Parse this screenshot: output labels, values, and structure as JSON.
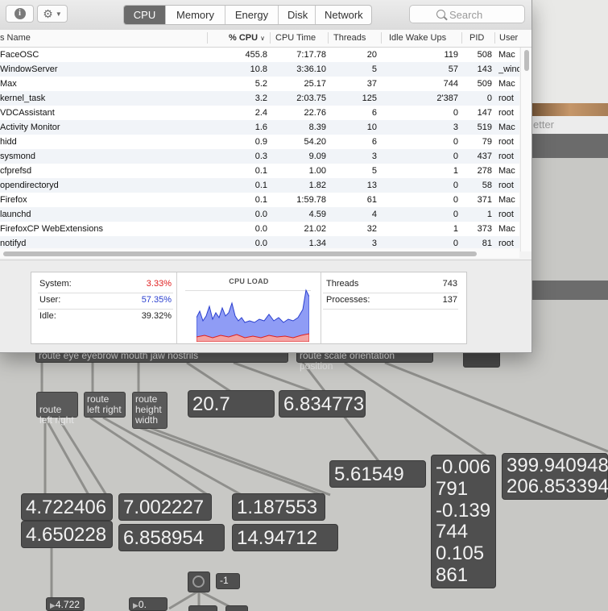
{
  "toolbar": {
    "info_icon": "info-icon",
    "gear_icon": "gear-icon",
    "tabs": [
      {
        "label": "CPU",
        "active": true
      },
      {
        "label": "Memory",
        "active": false
      },
      {
        "label": "Energy",
        "active": false
      },
      {
        "label": "Disk",
        "active": false
      },
      {
        "label": "Network",
        "active": false
      }
    ],
    "search_placeholder": "Search"
  },
  "table": {
    "columns": [
      "s Name",
      "% CPU",
      "CPU Time",
      "Threads",
      "Idle Wake Ups",
      "PID",
      "User"
    ],
    "rows": [
      [
        "FaceOSC",
        "455.8",
        "7:17.78",
        "20",
        "119",
        "508",
        "Mac"
      ],
      [
        "WindowServer",
        "10.8",
        "3:36.10",
        "5",
        "57",
        "143",
        "_wind"
      ],
      [
        "Max",
        "5.2",
        "25.17",
        "37",
        "744",
        "509",
        "Mac"
      ],
      [
        "kernel_task",
        "3.2",
        "2:03.75",
        "125",
        "2'387",
        "0",
        "root"
      ],
      [
        "VDCAssistant",
        "2.4",
        "22.76",
        "6",
        "0",
        "147",
        "root"
      ],
      [
        "Activity Monitor",
        "1.6",
        "8.39",
        "10",
        "3",
        "519",
        "Mac"
      ],
      [
        "hidd",
        "0.9",
        "54.20",
        "6",
        "0",
        "79",
        "root"
      ],
      [
        "sysmond",
        "0.3",
        "9.09",
        "3",
        "0",
        "437",
        "root"
      ],
      [
        "cfprefsd",
        "0.1",
        "1.00",
        "5",
        "1",
        "278",
        "Mac"
      ],
      [
        "opendirectoryd",
        "0.1",
        "1.82",
        "13",
        "0",
        "58",
        "root"
      ],
      [
        "Firefox",
        "0.1",
        "1:59.78",
        "61",
        "0",
        "371",
        "Mac"
      ],
      [
        "launchd",
        "0.0",
        "4.59",
        "4",
        "0",
        "1",
        "root"
      ],
      [
        "FirefoxCP WebExtensions",
        "0.0",
        "21.02",
        "32",
        "1",
        "373",
        "Mac"
      ],
      [
        "notifyd",
        "0.0",
        "1.34",
        "3",
        "0",
        "81",
        "root"
      ]
    ]
  },
  "summary": {
    "system_label": "System:",
    "system_value": "3.33%",
    "user_label": "User:",
    "user_value": "57.35%",
    "idle_label": "Idle:",
    "idle_value": "39.32%",
    "cpu_load_title": "CPU LOAD",
    "threads_label": "Threads",
    "threads_value": "743",
    "processes_label": "Processes:",
    "processes_value": "137",
    "colors": {
      "system": "#e02020",
      "user": "#2a3fcf"
    }
  },
  "background": {
    "ghost_text": "etter"
  },
  "patch": {
    "route_main": "route eye eyebrow mouth jaw nostrils",
    "route_scale": "route scale orientation position",
    "route_lr_1": "route left right",
    "route_lr_2": "route left right",
    "route_hw": "route height width",
    "num_20_7": "20.7",
    "num_6_834773": "6.834773",
    "num_5_61549": "5.61549",
    "num_col_a": "-0.006",
    "num_col_b": "791",
    "num_col_c": "-0.139",
    "num_col_d": "744",
    "num_col_e": "0.105",
    "num_col_f": "861",
    "num_399": "399.940948",
    "num_206": "206.853394",
    "num_4_722406": "4.722406",
    "num_4_650228": "4.650228",
    "num_7_002227": "7.002227",
    "num_6_858954": "6.858954",
    "num_1_187553": "1.187553",
    "num_14_94712": "14.94712",
    "small_4722": "4.722",
    "small_0": "0.",
    "small_minus1": "-1"
  }
}
